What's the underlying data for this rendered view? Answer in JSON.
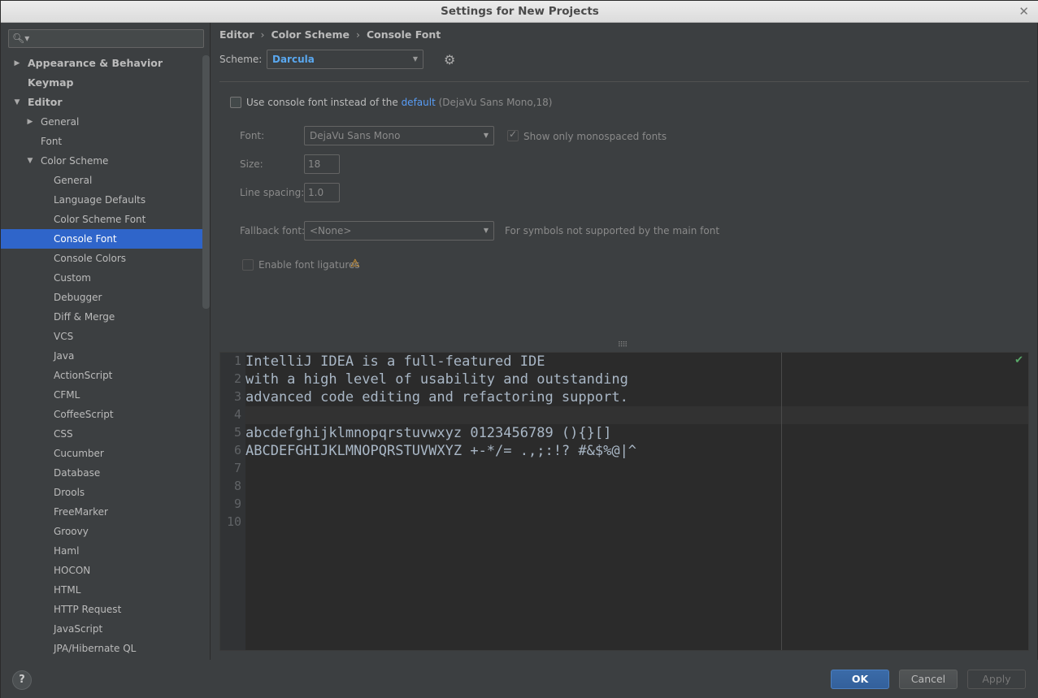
{
  "window": {
    "title": "Settings for New Projects"
  },
  "search": {
    "placeholder": ""
  },
  "sidebar": {
    "items": [
      {
        "label": "Appearance & Behavior",
        "level": 0,
        "bold": true,
        "arrow": "right"
      },
      {
        "label": "Keymap",
        "level": 0,
        "bold": true,
        "arrow": ""
      },
      {
        "label": "Editor",
        "level": 0,
        "bold": true,
        "arrow": "down"
      },
      {
        "label": "General",
        "level": 1,
        "arrow": "right"
      },
      {
        "label": "Font",
        "level": 1,
        "arrow": ""
      },
      {
        "label": "Color Scheme",
        "level": 1,
        "arrow": "down"
      },
      {
        "label": "General",
        "level": 2,
        "arrow": ""
      },
      {
        "label": "Language Defaults",
        "level": 2,
        "arrow": ""
      },
      {
        "label": "Color Scheme Font",
        "level": 2,
        "arrow": ""
      },
      {
        "label": "Console Font",
        "level": 2,
        "arrow": "",
        "selected": true
      },
      {
        "label": "Console Colors",
        "level": 2,
        "arrow": ""
      },
      {
        "label": "Custom",
        "level": 2,
        "arrow": ""
      },
      {
        "label": "Debugger",
        "level": 2,
        "arrow": ""
      },
      {
        "label": "Diff & Merge",
        "level": 2,
        "arrow": ""
      },
      {
        "label": "VCS",
        "level": 2,
        "arrow": ""
      },
      {
        "label": "Java",
        "level": 2,
        "arrow": ""
      },
      {
        "label": "ActionScript",
        "level": 2,
        "arrow": ""
      },
      {
        "label": "CFML",
        "level": 2,
        "arrow": ""
      },
      {
        "label": "CoffeeScript",
        "level": 2,
        "arrow": ""
      },
      {
        "label": "CSS",
        "level": 2,
        "arrow": ""
      },
      {
        "label": "Cucumber",
        "level": 2,
        "arrow": ""
      },
      {
        "label": "Database",
        "level": 2,
        "arrow": ""
      },
      {
        "label": "Drools",
        "level": 2,
        "arrow": ""
      },
      {
        "label": "FreeMarker",
        "level": 2,
        "arrow": ""
      },
      {
        "label": "Groovy",
        "level": 2,
        "arrow": ""
      },
      {
        "label": "Haml",
        "level": 2,
        "arrow": ""
      },
      {
        "label": "HOCON",
        "level": 2,
        "arrow": ""
      },
      {
        "label": "HTML",
        "level": 2,
        "arrow": ""
      },
      {
        "label": "HTTP Request",
        "level": 2,
        "arrow": ""
      },
      {
        "label": "JavaScript",
        "level": 2,
        "arrow": ""
      },
      {
        "label": "JPA/Hibernate QL",
        "level": 2,
        "arrow": ""
      }
    ]
  },
  "breadcrumb": {
    "part1": "Editor",
    "part2": "Color Scheme",
    "part3": "Console Font",
    "separator": "›"
  },
  "scheme": {
    "label": "Scheme:",
    "value": "Darcula"
  },
  "console_font": {
    "use_console_font_label": "Use console font instead of the",
    "default_link": "default",
    "default_detail": "(DejaVu Sans Mono,18)",
    "font_label": "Font:",
    "font_value": "DejaVu Sans Mono",
    "monospaced_label": "Show only monospaced fonts",
    "size_label": "Size:",
    "size_value": "18",
    "line_spacing_label": "Line spacing:",
    "line_spacing_value": "1.0",
    "fallback_label": "Fallback font:",
    "fallback_value": "<None>",
    "fallback_hint": "For symbols not supported by the main font",
    "ligatures_label": "Enable font ligatures"
  },
  "preview": {
    "line_numbers": [
      "1",
      "2",
      "3",
      "4",
      "5",
      "6",
      "7",
      "8",
      "9",
      "10"
    ],
    "lines": [
      "IntelliJ IDEA is a full-featured IDE",
      "with a high level of usability and outstanding",
      "advanced code editing and refactoring support.",
      "",
      "abcdefghijklmnopqrstuvwxyz 0123456789 (){}[]",
      "ABCDEFGHIJKLMNOPQRSTUVWXYZ +-*/= .,;:!? #&$%@|^"
    ]
  },
  "buttons": {
    "help": "?",
    "ok": "OK",
    "cancel": "Cancel",
    "apply": "Apply"
  },
  "colors": {
    "selection": "#2f65ca",
    "link": "#589df6",
    "background": "#3c3f41",
    "editor": "#2b2b2b",
    "warning": "#f0a732"
  }
}
